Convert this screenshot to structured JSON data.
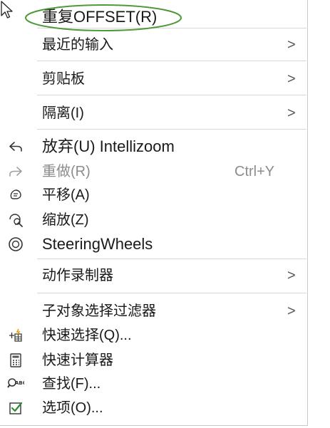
{
  "menu": {
    "items": [
      {
        "id": "repeat-offset",
        "label": "重复OFFSET(R)",
        "icon": "",
        "shortcut": "",
        "submenu": false,
        "disabled": false
      },
      {
        "id": "recent-input",
        "label": "最近的输入",
        "icon": "",
        "shortcut": "",
        "submenu": true,
        "disabled": false
      },
      {
        "id": "clipboard",
        "label": "剪贴板",
        "icon": "",
        "shortcut": "",
        "submenu": true,
        "disabled": false
      },
      {
        "id": "isolate",
        "label": "隔离(I)",
        "icon": "",
        "shortcut": "",
        "submenu": true,
        "disabled": false
      },
      {
        "id": "undo",
        "label": "放弃(U) Intellizoom",
        "icon": "undo-icon",
        "shortcut": "",
        "submenu": false,
        "disabled": false
      },
      {
        "id": "redo",
        "label": "重做(R)",
        "icon": "redo-icon",
        "shortcut": "Ctrl+Y",
        "submenu": false,
        "disabled": true
      },
      {
        "id": "pan",
        "label": "平移(A)",
        "icon": "pan-icon",
        "shortcut": "",
        "submenu": false,
        "disabled": false
      },
      {
        "id": "zoom",
        "label": "缩放(Z)",
        "icon": "zoom-icon",
        "shortcut": "",
        "submenu": false,
        "disabled": false
      },
      {
        "id": "steering-wheels",
        "label": "SteeringWheels",
        "icon": "steering-wheel-icon",
        "shortcut": "",
        "submenu": false,
        "disabled": false
      },
      {
        "id": "action-recorder",
        "label": "动作录制器",
        "icon": "",
        "shortcut": "",
        "submenu": true,
        "disabled": false
      },
      {
        "id": "subobject-filter",
        "label": "子对象选择过滤器",
        "icon": "",
        "shortcut": "",
        "submenu": true,
        "disabled": false
      },
      {
        "id": "quick-select",
        "label": "快速选择(Q)...",
        "icon": "quick-select-icon",
        "shortcut": "",
        "submenu": false,
        "disabled": false
      },
      {
        "id": "quick-calc",
        "label": "快速计算器",
        "icon": "calculator-icon",
        "shortcut": "",
        "submenu": false,
        "disabled": false
      },
      {
        "id": "find",
        "label": "查找(F)...",
        "icon": "find-icon",
        "shortcut": "",
        "submenu": false,
        "disabled": false
      },
      {
        "id": "options",
        "label": "选项(O)...",
        "icon": "options-check-icon",
        "shortcut": "",
        "submenu": false,
        "disabled": false
      }
    ],
    "submenu_arrow": ">",
    "highlight_color": "#4e9a3a"
  }
}
